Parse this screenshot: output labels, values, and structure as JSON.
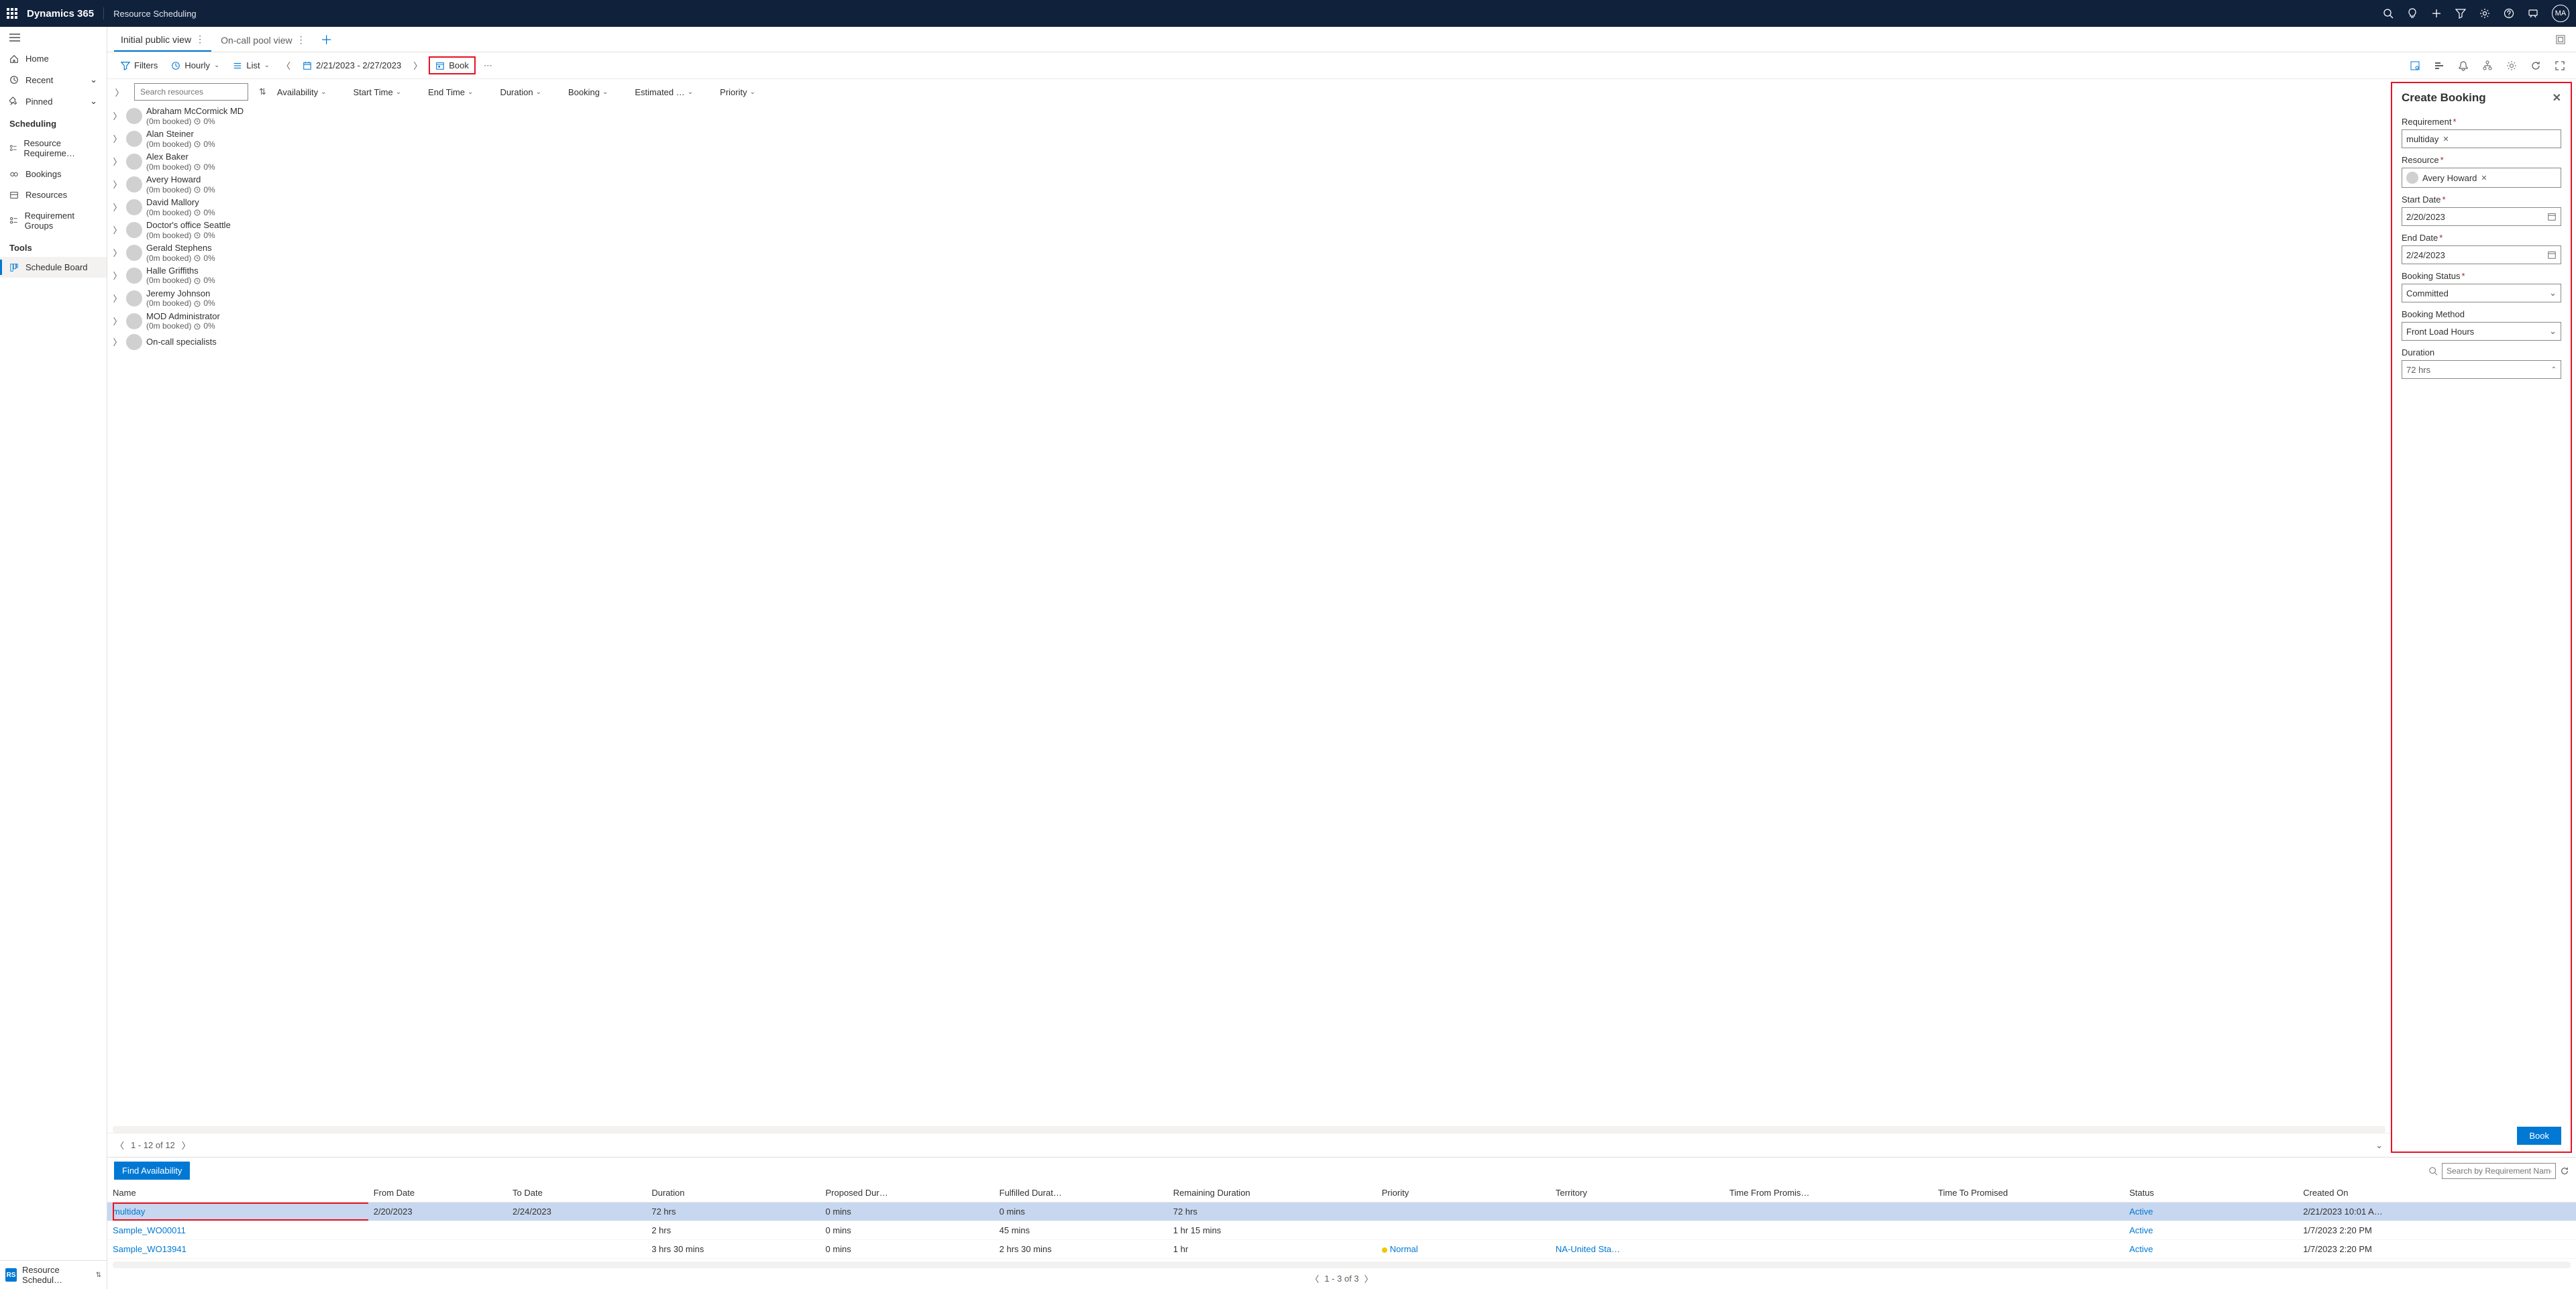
{
  "topbar": {
    "product": "Dynamics 365",
    "area": "Resource Scheduling",
    "avatar": "MA"
  },
  "leftnav": {
    "items_top": [
      {
        "icon": "home",
        "label": "Home"
      },
      {
        "icon": "clock",
        "label": "Recent",
        "chev": true
      },
      {
        "icon": "pin",
        "label": "Pinned",
        "chev": true
      }
    ],
    "section_scheduling": "Scheduling",
    "scheduling_items": [
      {
        "label": "Resource Requireme…"
      },
      {
        "label": "Bookings"
      },
      {
        "label": "Resources"
      },
      {
        "label": "Requirement Groups"
      }
    ],
    "section_tools": "Tools",
    "tools_items": [
      {
        "label": "Schedule Board",
        "active": true
      }
    ],
    "switcher_badge": "RS",
    "switcher_label": "Resource Schedul…"
  },
  "tabs": [
    {
      "label": "Initial public view",
      "active": true
    },
    {
      "label": "On-call pool view",
      "active": false
    }
  ],
  "toolbar": {
    "filters": "Filters",
    "hourly": "Hourly",
    "list": "List",
    "date_range": "2/21/2023 - 2/27/2023",
    "book": "Book"
  },
  "grid_columns": [
    "Availability",
    "Start Time",
    "End Time",
    "Duration",
    "Booking",
    "Estimated …",
    "Priority"
  ],
  "search_placeholder": "Search resources",
  "resources": [
    {
      "name": "Abraham McCormick MD",
      "sub": "(0m booked)",
      "pct": "0%"
    },
    {
      "name": "Alan Steiner",
      "sub": "(0m booked)",
      "pct": "0%"
    },
    {
      "name": "Alex Baker",
      "sub": "(0m booked)",
      "pct": "0%"
    },
    {
      "name": "Avery Howard",
      "sub": "(0m booked)",
      "pct": "0%"
    },
    {
      "name": "David Mallory",
      "sub": "(0m booked)",
      "pct": "0%"
    },
    {
      "name": "Doctor's office Seattle",
      "sub": "(0m booked)",
      "pct": "0%"
    },
    {
      "name": "Gerald Stephens",
      "sub": "(0m booked)",
      "pct": "0%"
    },
    {
      "name": "Halle Griffiths",
      "sub": "(0m booked)",
      "pct": "0%"
    },
    {
      "name": "Jeremy Johnson",
      "sub": "(0m booked)",
      "pct": "0%"
    },
    {
      "name": "MOD Administrator",
      "sub": "(0m booked)",
      "pct": "0%"
    },
    {
      "name": "On-call specialists",
      "sub": "",
      "pct": ""
    }
  ],
  "res_pager": "1 - 12 of 12",
  "create_panel": {
    "title": "Create Booking",
    "labels": {
      "requirement": "Requirement",
      "resource": "Resource",
      "start": "Start Date",
      "end": "End Date",
      "status": "Booking Status",
      "method": "Booking Method",
      "duration": "Duration"
    },
    "values": {
      "requirement": "multiday",
      "resource": "Avery Howard",
      "start": "2/20/2023",
      "end": "2/24/2023",
      "status": "Committed",
      "method": "Front Load Hours",
      "duration": "72 hrs"
    },
    "book": "Book"
  },
  "bottom": {
    "find": "Find Availability",
    "search_placeholder": "Search by Requirement Name",
    "columns": [
      "Name",
      "From Date",
      "To Date",
      "Duration",
      "Proposed Dur…",
      "Fulfilled Durat…",
      "Remaining Duration",
      "Priority",
      "Territory",
      "Time From Promis…",
      "Time To Promised",
      "Status",
      "Created On"
    ],
    "rows": [
      {
        "name": "multiday",
        "from": "2/20/2023",
        "to": "2/24/2023",
        "dur": "72 hrs",
        "prop": "0 mins",
        "ful": "0 mins",
        "rem": "72 hrs",
        "priority": "",
        "territory": "",
        "tfp": "",
        "ttp": "",
        "status": "Active",
        "created": "2/21/2023 10:01 A…",
        "selected": true
      },
      {
        "name": "Sample_WO00011",
        "from": "",
        "to": "",
        "dur": "2 hrs",
        "prop": "0 mins",
        "ful": "45 mins",
        "rem": "1 hr 15 mins",
        "priority": "",
        "territory": "",
        "tfp": "",
        "ttp": "",
        "status": "Active",
        "created": "1/7/2023 2:20 PM"
      },
      {
        "name": "Sample_WO13941",
        "from": "",
        "to": "",
        "dur": "3 hrs 30 mins",
        "prop": "0 mins",
        "ful": "2 hrs 30 mins",
        "rem": "1 hr",
        "priority": "Normal",
        "priority_dot": true,
        "territory": "NA-United Sta…",
        "tfp": "",
        "ttp": "",
        "status": "Active",
        "created": "1/7/2023 2:20 PM"
      }
    ],
    "pager": "1 - 3 of 3"
  }
}
